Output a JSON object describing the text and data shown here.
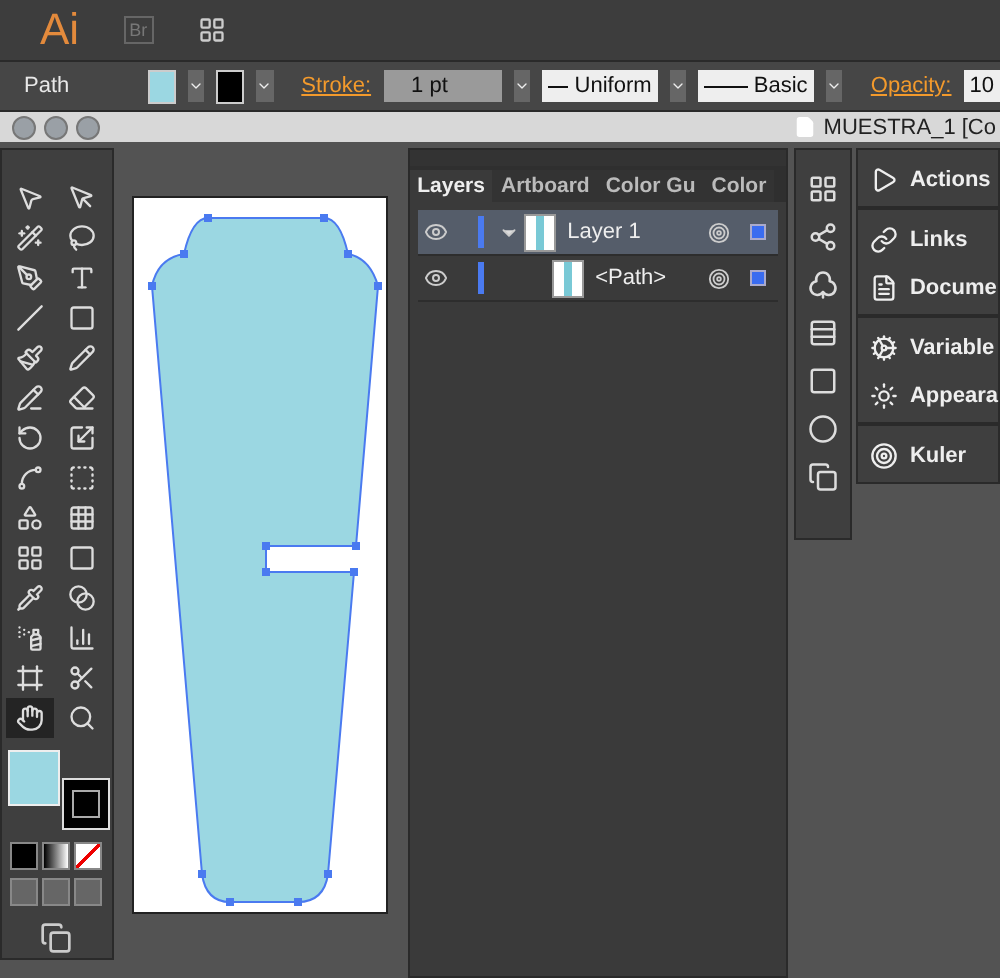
{
  "app_bar": {
    "logo": "Ai",
    "bridge": "Br"
  },
  "control_bar": {
    "selection": "Path",
    "stroke_label": "Stroke:",
    "stroke_weight": "1 pt",
    "profile": "Uniform",
    "brush": "Basic",
    "opacity_label": "Opacity:",
    "opacity_value": "10"
  },
  "document": {
    "title": "MUESTRA_1 [Co"
  },
  "toolbox": {
    "tools": [
      {
        "selected": false
      },
      {
        "selected": false
      },
      {
        "selected": false
      },
      {
        "selected": false
      },
      {
        "selected": false
      },
      {
        "selected": false
      },
      {
        "selected": false
      },
      {
        "selected": false
      },
      {
        "selected": false
      },
      {
        "selected": false
      },
      {
        "selected": false
      },
      {
        "selected": false
      },
      {
        "selected": false
      },
      {
        "selected": false
      },
      {
        "selected": false
      },
      {
        "selected": false
      },
      {
        "selected": false
      },
      {
        "selected": false
      },
      {
        "selected": false
      },
      {
        "selected": false
      },
      {
        "selected": false
      },
      {
        "selected": false
      },
      {
        "selected": false
      },
      {
        "selected": false
      },
      {
        "selected": false
      },
      {
        "selected": false
      },
      {
        "selected": true
      },
      {
        "selected": false
      }
    ]
  },
  "layers_panel": {
    "tabs": [
      {
        "label": "Layers",
        "selected": true
      },
      {
        "label": "Artboard",
        "selected": false
      },
      {
        "label": "Color Gu",
        "selected": false
      },
      {
        "label": "Color",
        "selected": false
      }
    ],
    "layers": [
      {
        "name": "Layer 1",
        "expanded": true,
        "selected": true,
        "children": [
          {
            "name": "<Path>",
            "selected": false
          }
        ]
      }
    ]
  },
  "dock": {
    "groups": [
      [
        "Actions"
      ],
      [
        "Links",
        "Docume"
      ],
      [
        "Variable",
        "Appeara"
      ],
      [
        "Kuler"
      ]
    ]
  }
}
